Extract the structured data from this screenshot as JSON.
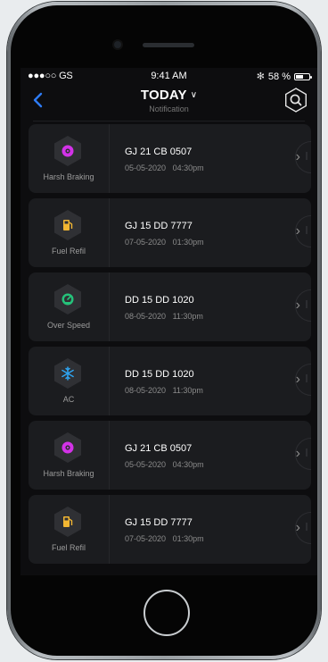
{
  "status": {
    "carrier": "●●●○○ GS",
    "time": "9:41 AM",
    "battery": "58 %",
    "battery_level": 0.58
  },
  "nav": {
    "title": "TODAY",
    "subtitle": "Notification"
  },
  "colors": {
    "accent": "#2e7cf6",
    "harsh_braking": "#d332e8",
    "fuel": "#f2b632",
    "speed": "#25c27a",
    "ac": "#2fa4f0"
  },
  "notifications": [
    {
      "type": "Harsh Braking",
      "icon": "brake-icon",
      "plate": "GJ 21 CB 0507",
      "date": "05-05-2020",
      "time": "04:30pm"
    },
    {
      "type": "Fuel Refil",
      "icon": "fuel-pump-icon",
      "plate": "GJ 15 DD 7777",
      "date": "07-05-2020",
      "time": "01:30pm"
    },
    {
      "type": "Over Speed",
      "icon": "speedometer-icon",
      "plate": "DD 15 DD 1020",
      "date": "08-05-2020",
      "time": "11:30pm"
    },
    {
      "type": "AC",
      "icon": "snowflake-icon",
      "plate": "DD 15 DD 1020",
      "date": "08-05-2020",
      "time": "11:30pm"
    },
    {
      "type": "Harsh Braking",
      "icon": "brake-icon",
      "plate": "GJ 21 CB 0507",
      "date": "05-05-2020",
      "time": "04:30pm"
    },
    {
      "type": "Fuel Refil",
      "icon": "fuel-pump-icon",
      "plate": "GJ 15 DD 7777",
      "date": "07-05-2020",
      "time": "01:30pm"
    }
  ]
}
